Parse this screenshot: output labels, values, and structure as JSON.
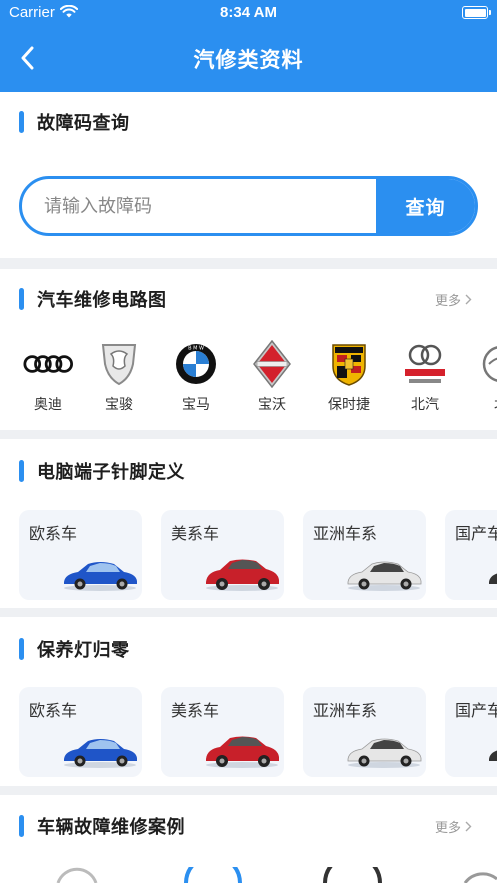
{
  "status": {
    "carrier": "Carrier",
    "time": "8:34 AM"
  },
  "nav": {
    "title": "汽修类资料",
    "back_icon": "chevron-left-icon"
  },
  "fault_code": {
    "title": "故障码查询",
    "placeholder": "请输入故障码",
    "button": "查询"
  },
  "wiring": {
    "title": "汽车维修电路图",
    "more": "更多",
    "brands": [
      {
        "name": "奥迪",
        "icon": "audi-logo"
      },
      {
        "name": "宝骏",
        "icon": "baojun-logo"
      },
      {
        "name": "宝马",
        "icon": "bmw-logo"
      },
      {
        "name": "宝沃",
        "icon": "borgward-logo"
      },
      {
        "name": "保时捷",
        "icon": "porsche-logo"
      },
      {
        "name": "北汽",
        "icon": "baic-logo"
      },
      {
        "name": "北",
        "icon": "partial-brand-logo"
      }
    ]
  },
  "pin_def": {
    "title": "电脑端子针脚定义",
    "tiles": [
      {
        "label": "欧系车",
        "color": "#1f55c8"
      },
      {
        "label": "美系车",
        "color": "#c8202a"
      },
      {
        "label": "亚洲车系",
        "color": "#e6e6e6"
      },
      {
        "label": "国产车",
        "color": "#333333"
      }
    ]
  },
  "maint_reset": {
    "title": "保养灯归零",
    "tiles": [
      {
        "label": "欧系车",
        "color": "#1f55c8"
      },
      {
        "label": "美系车",
        "color": "#c8202a"
      },
      {
        "label": "亚洲车系",
        "color": "#e6e6e6"
      },
      {
        "label": "国产车",
        "color": "#333333"
      }
    ]
  },
  "cases": {
    "title": "车辆故障维修案例",
    "more": "更多"
  },
  "colors": {
    "accent": "#2b8ff0",
    "background": "#eef0f3",
    "tile": "#f2f5fa"
  }
}
